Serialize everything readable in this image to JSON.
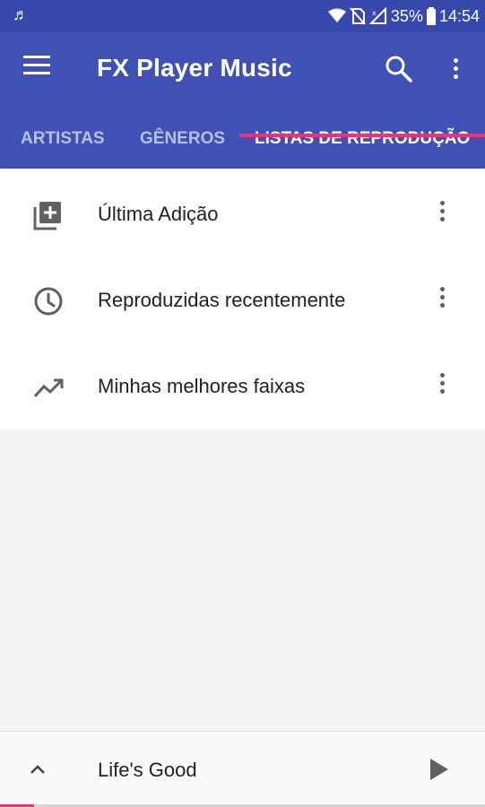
{
  "status_bar": {
    "notification_icon": "music-note-icon",
    "battery": "35%",
    "time": "14:54",
    "icons": [
      "wifi-icon",
      "no-sim-icon",
      "signal-icon",
      "battery-icon"
    ]
  },
  "app_bar": {
    "title": "FX Player Music",
    "color": "#3f51b5",
    "menu_icon": "hamburger-menu-icon",
    "search_icon": "search-icon",
    "more_icon": "more-vert-icon"
  },
  "tabs": [
    {
      "label": "ARTISTAS",
      "active": false
    },
    {
      "label": "GÊNEROS",
      "active": false
    },
    {
      "label": "LISTAS DE REPRODUÇÃO",
      "active": true
    }
  ],
  "accent_color": "#ff2d6f",
  "playlists": [
    {
      "label": "Última Adição",
      "icon": "playlist-add-icon"
    },
    {
      "label": "Reproduzidas recentemente",
      "icon": "clock-icon"
    },
    {
      "label": "Minhas melhores faixas",
      "icon": "trending-up-icon"
    }
  ],
  "player": {
    "song_title": "Life's Good",
    "expand_icon": "chevron-up-icon",
    "play_icon": "play-icon",
    "progress": 0.07
  }
}
